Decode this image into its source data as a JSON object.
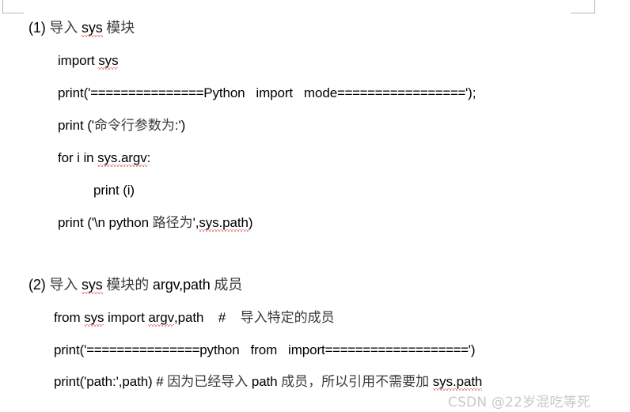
{
  "document": {
    "type": "word-document-screenshot",
    "background_color": "#ffffff",
    "text_color": "#000000",
    "cjk_text_color": "#3a3a3a",
    "spellcheck_underline_color": "#e02020",
    "margin_mark_color": "#b6b6b6"
  },
  "sections": [
    {
      "id": "section-1",
      "heading": {
        "number": "(1)",
        "cjk_lead": "导入",
        "code_term": "sys",
        "cjk_tail": "模块",
        "full_text": "(1) 导入 sys 模块"
      },
      "code_lines": [
        {
          "id": "line-1-1",
          "text": "import sys",
          "indent": "normal"
        },
        {
          "id": "line-1-2",
          "prefix": "print('",
          "sep1": "===============",
          "word1": "Python",
          "gap1": "   ",
          "word2": "import",
          "gap2": "   ",
          "word3": "mode",
          "sep2": "=================",
          "suffix": "');",
          "full_text": "print('===============Python   import   mode=================');",
          "indent": "normal"
        },
        {
          "id": "line-1-3",
          "latin_prefix": "print ('",
          "cjk": "命令行参数为",
          "latin_suffix": ":')",
          "full_text": "print ('命令行参数为:')",
          "indent": "normal"
        },
        {
          "id": "line-1-4",
          "text": "for i in sys.argv:",
          "indent": "normal"
        },
        {
          "id": "line-1-5",
          "text": "print (i)",
          "indent": "deep"
        },
        {
          "id": "line-1-6",
          "latin_prefix": "print ('\\n python ",
          "cjk": "路径为",
          "latin_suffix": "',sys.path)",
          "full_text": "print ('\\n python 路径为',sys.path)",
          "indent": "outdent"
        }
      ]
    },
    {
      "id": "section-2",
      "heading": {
        "number": "(2)",
        "cjk_lead": "导入",
        "code_term": "sys",
        "cjk_mid": "模块的",
        "code_term2": "argv,path",
        "cjk_tail": "成员",
        "full_text": "(2) 导入 sys 模块的 argv,path 成员"
      },
      "code_lines": [
        {
          "id": "line-2-1",
          "latin": "from sys import argv,path",
          "gap": "   ",
          "hash": "#",
          "cjk_comment": "导入特定的成员",
          "full_text": "from sys import argv,path   #   导入特定的成员",
          "indent": "normal"
        },
        {
          "id": "line-2-2",
          "prefix": "print('",
          "sep1": "===============",
          "word1": "python",
          "gap1": "   ",
          "word2": "from",
          "gap2": "   ",
          "word3": "import",
          "sep2": "===================",
          "suffix": "')",
          "full_text": "print('===============python   from   import===================')",
          "indent": "normal"
        },
        {
          "id": "line-2-3",
          "latin_prefix": "print('path:',path) # ",
          "cjk_comment": "因为已经导入 path 成员，所以引用不需要加 ",
          "latin_suffix": "sys.path",
          "cjk_a": "因为已经导入",
          "mid_code": "path",
          "cjk_b": "成员，所以引用不需要加",
          "tail_code": "sys.path",
          "full_text": "print('path:',path) # 因为已经导入 path 成员，所以引用不需要加 sys.path",
          "indent": "outdent"
        }
      ]
    }
  ],
  "spellcheck_terms": [
    "sys",
    "argv",
    "sys.argv",
    "sys.path"
  ],
  "watermark": {
    "text": "CSDN @22岁混吃等死",
    "color": "#c9c9c9"
  }
}
